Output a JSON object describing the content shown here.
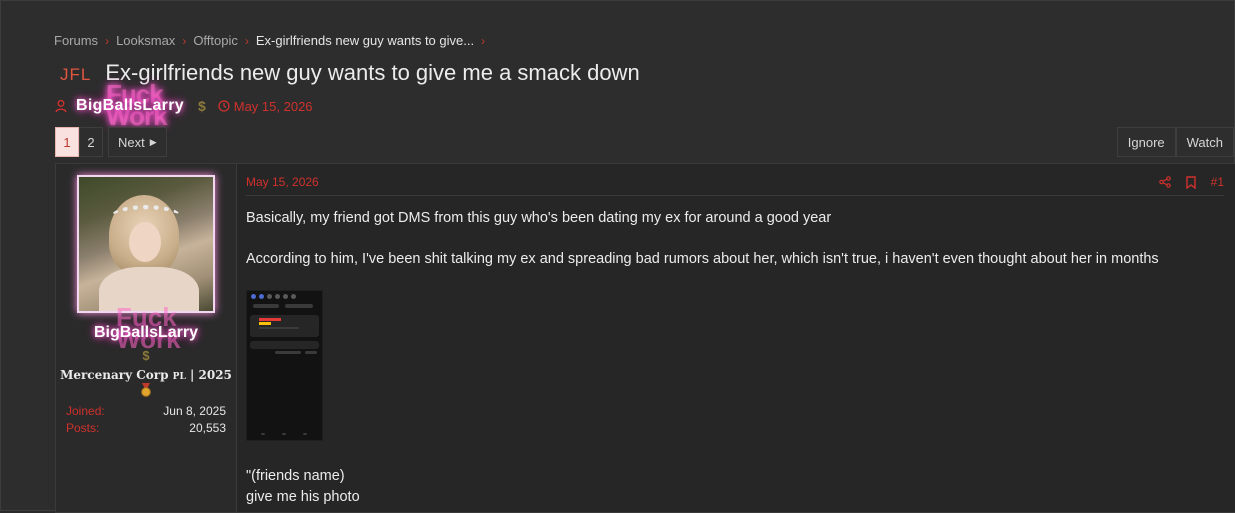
{
  "breadcrumb": [
    {
      "label": "Forums"
    },
    {
      "label": "Looksmax"
    },
    {
      "label": "Offtopic"
    },
    {
      "label": "Ex-girlfriends new guy wants to give..."
    }
  ],
  "thread": {
    "prefix": "JFL",
    "title": "Ex-girlfriends new guy wants to give me a smack down",
    "author": "BigBallsLarry",
    "author_watermark": "Fuck Work",
    "date": "May 15, 2026"
  },
  "pagination": {
    "pages": [
      "1",
      "2"
    ],
    "current": "1",
    "next_label": "Next"
  },
  "thread_actions": {
    "ignore": "Ignore",
    "watch": "Watch"
  },
  "user": {
    "name": "BigBallsLarry",
    "dollar": "$",
    "title_main": "Mercenary Corp",
    "title_sub": "PL",
    "title_year": "| 2025",
    "joined_label": "Joined:",
    "joined_value": "Jun 8, 2025",
    "posts_label": "Posts:",
    "posts_value": "20,553"
  },
  "post": {
    "date": "May 15, 2026",
    "number": "#1",
    "paragraphs": [
      "Basically, my friend got DMS from this guy who's been dating my ex for around a good year",
      "According to him, I've been shit talking my ex and spreading bad rumors about her, which isn't true, i haven't even thought about her in months"
    ],
    "quote_lines": [
      "\"(friends name)",
      "give me his photo"
    ]
  },
  "colors": {
    "accent": "#d0312d",
    "glow": "#ff6ad5",
    "background": "#2d2d2d"
  },
  "icons": [
    "user-icon",
    "clock-icon",
    "share-icon",
    "bookmark-icon",
    "chevron-right-icon",
    "caret-right-icon",
    "medal-icon"
  ]
}
